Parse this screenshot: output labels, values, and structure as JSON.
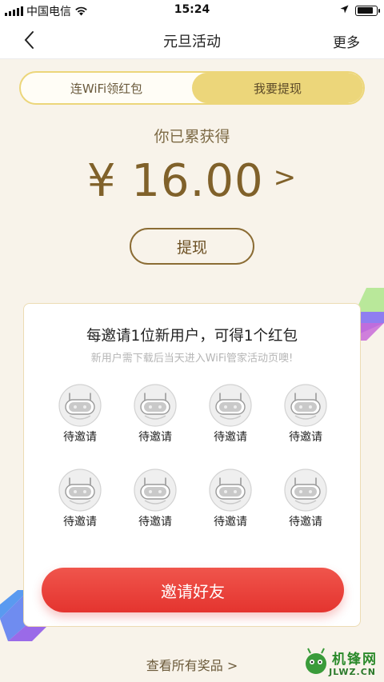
{
  "status_bar": {
    "carrier": "中国电信",
    "time": "15:24",
    "battery_level": 0.85
  },
  "nav": {
    "title": "元旦活动",
    "more": "更多"
  },
  "tabs": [
    {
      "label": "连WiFi领红包",
      "active": false
    },
    {
      "label": "我要提现",
      "active": true
    }
  ],
  "earnings": {
    "label": "你已累获得",
    "amount": "¥ 16.00",
    "arrow": ">",
    "withdraw_button": "提现"
  },
  "invite_card": {
    "title": "每邀请1位新用户，可得1个红包",
    "subtitle": "新用户需下载后当天进入WiFi管家活动页噢!",
    "slots": [
      {
        "label": "待邀请"
      },
      {
        "label": "待邀请"
      },
      {
        "label": "待邀请"
      },
      {
        "label": "待邀请"
      },
      {
        "label": "待邀请"
      },
      {
        "label": "待邀请"
      },
      {
        "label": "待邀请"
      },
      {
        "label": "待邀请"
      }
    ],
    "invite_button": "邀请好友"
  },
  "footer": {
    "all_prizes": "查看所有奖品 >"
  },
  "watermark": {
    "text": "机锋网",
    "domain": "JLWZ.CN"
  },
  "colors": {
    "accent_gold": "#ecd67a",
    "amount_brown": "#80612a",
    "invite_red": "#e4342f",
    "background": "#f8f3ea"
  }
}
